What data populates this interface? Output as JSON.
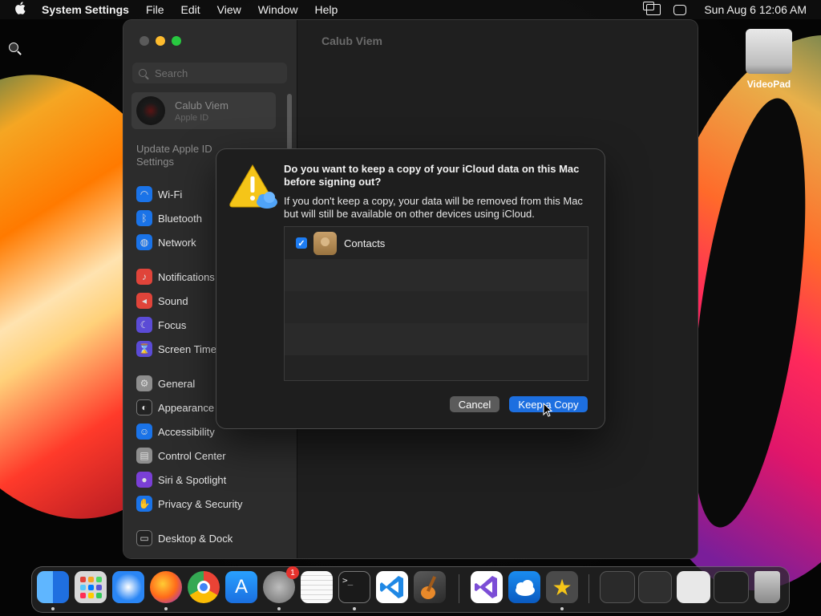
{
  "menubar": {
    "app_name": "System Settings",
    "items": [
      "File",
      "Edit",
      "View",
      "Window",
      "Help"
    ],
    "clock": "Sun Aug 6  12:06 AM"
  },
  "desktop": {
    "drive_label": "VideoPad"
  },
  "window": {
    "main_title": "Calub Viem",
    "search_placeholder": "Search",
    "account": {
      "name": "Calub Viem",
      "subtitle": "Apple ID"
    },
    "update_text": "Update Apple ID Settings",
    "sidebar_items": [
      {
        "label": "Wi-Fi",
        "icon": "wifi-icon",
        "color": "#1a73e8"
      },
      {
        "label": "Bluetooth",
        "icon": "bluetooth-icon",
        "color": "#1a73e8"
      },
      {
        "label": "Network",
        "icon": "globe-icon",
        "color": "#1a73e8"
      },
      {
        "label": "Notifications",
        "icon": "bell-icon",
        "color": "#e0443a"
      },
      {
        "label": "Sound",
        "icon": "speaker-icon",
        "color": "#e0443a"
      },
      {
        "label": "Focus",
        "icon": "moon-icon",
        "color": "#5b4bd6"
      },
      {
        "label": "Screen Time",
        "icon": "hourglass-icon",
        "color": "#5b4bd6"
      },
      {
        "label": "General",
        "icon": "gear-icon",
        "color": "#8e8e8e"
      },
      {
        "label": "Appearance",
        "icon": "appearance-icon",
        "color": "#222222"
      },
      {
        "label": "Accessibility",
        "icon": "accessibility-icon",
        "color": "#1a73e8"
      },
      {
        "label": "Control Center",
        "icon": "control-center-icon",
        "color": "#8e8e8e"
      },
      {
        "label": "Siri & Spotlight",
        "icon": "siri-icon",
        "color": "#7a3fd6"
      },
      {
        "label": "Privacy & Security",
        "icon": "hand-icon",
        "color": "#1a73e8"
      },
      {
        "label": "Desktop & Dock",
        "icon": "dock-icon",
        "color": "#222222"
      }
    ]
  },
  "dialog": {
    "title": "Do you want to keep a copy of your iCloud data on this Mac before signing out?",
    "message": "If you don't keep a copy, your data will be removed from this Mac but will still be available on other devices using iCloud.",
    "items": [
      {
        "label": "Contacts",
        "checked": true
      }
    ],
    "cancel_label": "Cancel",
    "keep_label": "Keep a Copy"
  },
  "dock": {
    "apps": [
      {
        "name": "finder-icon",
        "color": "#3b8ef0"
      },
      {
        "name": "launchpad-icon",
        "color": "#d8d8d8"
      },
      {
        "name": "safari-icon",
        "color": "#2a86f5"
      },
      {
        "name": "firefox-icon",
        "color": "#ff6a1a"
      },
      {
        "name": "chrome-icon",
        "color": "#ffffff"
      },
      {
        "name": "app-store-icon",
        "color": "#1f8cf5"
      },
      {
        "name": "system-settings-icon",
        "color": "#8a8a8a",
        "badge": "1"
      },
      {
        "name": "textedit-icon",
        "color": "#f2f2f2"
      },
      {
        "name": "terminal-icon",
        "color": "#1a1a1a"
      },
      {
        "name": "vscode-icon",
        "color": "#ffffff"
      },
      {
        "name": "garageband-icon",
        "color": "#3a3a3a"
      },
      {
        "name": "visual-studio-icon",
        "color": "#ffffff"
      },
      {
        "name": "weather-icon",
        "color": "#2a8cf0"
      },
      {
        "name": "reeder-icon",
        "color": "#555555"
      }
    ],
    "minimized": [
      "window-thumbnail-1",
      "window-thumbnail-2",
      "window-thumbnail-3",
      "window-thumbnail-4"
    ],
    "trash": "trash-icon"
  }
}
